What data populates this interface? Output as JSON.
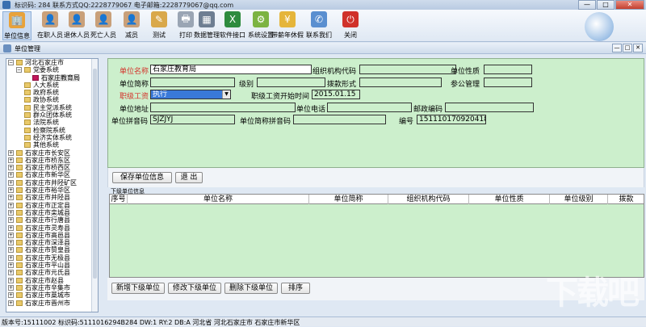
{
  "window": {
    "title": "标识码: 284 联系方式QQ:2228779067 电子邮箱:2228779067@qq.com",
    "min": "—",
    "max": "□",
    "close": "✕"
  },
  "toolbar": [
    {
      "label": "单位信息",
      "icon": "building-icon",
      "glyph": "🏢",
      "color": "#e8a23a"
    },
    {
      "label": "在职人员",
      "icon": "person-icon",
      "glyph": "👤",
      "color": "#c9a07a"
    },
    {
      "label": "退休人员",
      "icon": "person-icon",
      "glyph": "👤",
      "color": "#c9a07a"
    },
    {
      "label": "死亡人员",
      "icon": "person-icon",
      "glyph": "👤",
      "color": "#c9a07a"
    },
    {
      "label": "减员",
      "icon": "person-icon",
      "glyph": "👤",
      "color": "#c9a07a"
    },
    {
      "label": "测试",
      "icon": "test-icon",
      "glyph": "✎",
      "color": "#d9a84a"
    },
    {
      "label": "打印",
      "icon": "printer-icon",
      "glyph": "🖶",
      "color": "#9aa5b4"
    },
    {
      "label": "数据管理",
      "icon": "database-icon",
      "glyph": "▦",
      "color": "#6e7e92"
    },
    {
      "label": "软件接口",
      "icon": "excel-icon",
      "glyph": "X",
      "color": "#2e8b3e"
    },
    {
      "label": "系统设置",
      "icon": "settings-icon",
      "glyph": "⚙",
      "color": "#7cb342"
    },
    {
      "label": "带薪年休假",
      "icon": "money-icon",
      "glyph": "¥",
      "color": "#e5b53a"
    },
    {
      "label": "联系我们",
      "icon": "contact-icon",
      "glyph": "✆",
      "color": "#5a8fd0"
    },
    {
      "label": "关闭",
      "icon": "power-icon",
      "glyph": "⏻",
      "color": "#d0322a"
    }
  ],
  "subwindow": {
    "title": "单位管理"
  },
  "tree": [
    {
      "label": "河北石家庄市",
      "level": 0,
      "pm": "−",
      "selected": false
    },
    {
      "label": "党委系统",
      "level": 1,
      "pm": "−",
      "selected": false
    },
    {
      "label": "石家庄教育局",
      "level": 2,
      "pm": "",
      "selected": true
    },
    {
      "label": "人大系统",
      "level": 1,
      "pm": "",
      "selected": false
    },
    {
      "label": "政府系统",
      "level": 1,
      "pm": "",
      "selected": false
    },
    {
      "label": "政协系统",
      "level": 1,
      "pm": "",
      "selected": false
    },
    {
      "label": "民主党派系统",
      "level": 1,
      "pm": "",
      "selected": false
    },
    {
      "label": "群众团体系统",
      "level": 1,
      "pm": "",
      "selected": false
    },
    {
      "label": "法院系统",
      "level": 1,
      "pm": "",
      "selected": false
    },
    {
      "label": "检察院系统",
      "level": 1,
      "pm": "",
      "selected": false
    },
    {
      "label": "经济实体系统",
      "level": 1,
      "pm": "",
      "selected": false
    },
    {
      "label": "其他系统",
      "level": 1,
      "pm": "",
      "selected": false
    },
    {
      "label": "石家庄市长安区",
      "level": 0,
      "pm": "+",
      "selected": false
    },
    {
      "label": "石家庄市桥东区",
      "level": 0,
      "pm": "+",
      "selected": false
    },
    {
      "label": "石家庄市桥西区",
      "level": 0,
      "pm": "+",
      "selected": false
    },
    {
      "label": "石家庄市新华区",
      "level": 0,
      "pm": "+",
      "selected": false
    },
    {
      "label": "石家庄市井陉矿区",
      "level": 0,
      "pm": "+",
      "selected": false
    },
    {
      "label": "石家庄市裕华区",
      "level": 0,
      "pm": "+",
      "selected": false
    },
    {
      "label": "石家庄市井陉县",
      "level": 0,
      "pm": "+",
      "selected": false
    },
    {
      "label": "石家庄市正定县",
      "level": 0,
      "pm": "+",
      "selected": false
    },
    {
      "label": "石家庄市栾城县",
      "level": 0,
      "pm": "+",
      "selected": false
    },
    {
      "label": "石家庄市行唐县",
      "level": 0,
      "pm": "+",
      "selected": false
    },
    {
      "label": "石家庄市灵寿县",
      "level": 0,
      "pm": "+",
      "selected": false
    },
    {
      "label": "石家庄市高邑县",
      "level": 0,
      "pm": "+",
      "selected": false
    },
    {
      "label": "石家庄市深泽县",
      "level": 0,
      "pm": "+",
      "selected": false
    },
    {
      "label": "石家庄市赞皇县",
      "level": 0,
      "pm": "+",
      "selected": false
    },
    {
      "label": "石家庄市无极县",
      "level": 0,
      "pm": "+",
      "selected": false
    },
    {
      "label": "石家庄市平山县",
      "level": 0,
      "pm": "+",
      "selected": false
    },
    {
      "label": "石家庄市元氏县",
      "level": 0,
      "pm": "+",
      "selected": false
    },
    {
      "label": "石家庄市赵县",
      "level": 0,
      "pm": "+",
      "selected": false
    },
    {
      "label": "石家庄市辛集市",
      "level": 0,
      "pm": "+",
      "selected": false
    },
    {
      "label": "石家庄市藁城市",
      "level": 0,
      "pm": "+",
      "selected": false
    },
    {
      "label": "石家庄市晋州市",
      "level": 0,
      "pm": "+",
      "selected": false
    }
  ],
  "form": {
    "unit_name_label": "单位名称",
    "unit_name": "石家庄教育局",
    "org_code_label": "组织机构代码",
    "org_code": "",
    "unit_nature_label": "单位性质",
    "unit_nature": "",
    "short_name_label": "单位简称",
    "short_name": "",
    "level_label": "级别",
    "level": "",
    "funding_label": "拨款形式",
    "funding": "",
    "civil_label": "参公管理",
    "civil": "",
    "salary_label": "职级工资",
    "salary": "执行",
    "salary_start_label": "职级工资开始时间",
    "salary_start": "2015.01.15",
    "address_label": "单位地址",
    "address": "",
    "phone_label": "单位电话",
    "phone": "",
    "postcode_label": "邮政编码",
    "postcode": "",
    "pinyin_label": "单位拼音码",
    "pinyin": "SJZJYJ",
    "short_pinyin_label": "单位简称拼音码",
    "short_pinyin": "",
    "number_label": "编号",
    "number": "151110170920418"
  },
  "actions": {
    "save": "保存单位信息",
    "exit": "退 出"
  },
  "grid": {
    "label": "下级单位信息",
    "columns": [
      "序号",
      "单位名称",
      "单位简称",
      "组织机构代码",
      "单位性质",
      "单位级别",
      "拨款"
    ]
  },
  "bottom_actions": {
    "add": "新增下级单位",
    "edit": "修改下级单位",
    "delete": "删除下级单位",
    "sort": "排序"
  },
  "status": {
    "text": "版本号:15111002 标识码:5111016294B284 DW:1 RY:2 DB:A 河北省 河北石家庄市 石家庄市新华区"
  },
  "watermark": "下载吧"
}
